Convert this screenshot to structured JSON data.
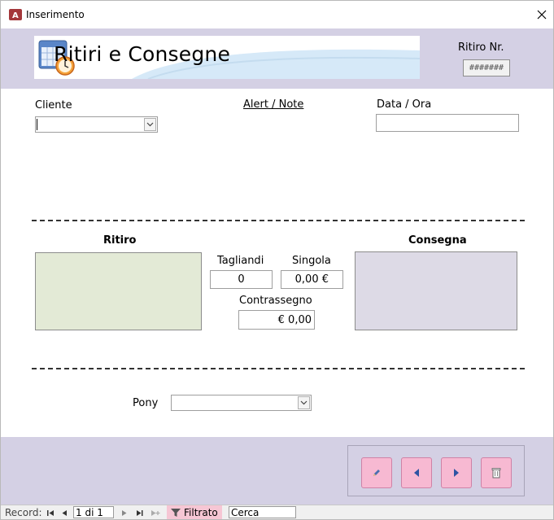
{
  "window": {
    "title": "Inserimento",
    "close_icon": "close-icon"
  },
  "header": {
    "title": "Ritiri e Consegne",
    "ritiro_nr_label": "Ritiro Nr.",
    "ritiro_nr_value": "#######"
  },
  "form": {
    "cliente_label": "Cliente",
    "cliente_value": "",
    "alert_label": "Alert / Note",
    "data_ora_label": "Data / Ora",
    "data_ora_value": "",
    "ritiro_label": "Ritiro",
    "consegna_label": "Consegna",
    "tagliandi_label": "Tagliandi",
    "tagliandi_value": "0",
    "singola_label": "Singola",
    "singola_value": "0,00 €",
    "contrassegno_label": "Contrassegno",
    "contrassegno_value": "€ 0,00",
    "pony_label": "Pony",
    "pony_value": ""
  },
  "nav_buttons": [
    {
      "name": "edit-button",
      "icon": "pencil-icon"
    },
    {
      "name": "previous-button",
      "icon": "triangle-left-icon"
    },
    {
      "name": "next-button",
      "icon": "triangle-right-icon"
    },
    {
      "name": "delete-button",
      "icon": "trash-icon"
    }
  ],
  "statusbar": {
    "record_label": "Record:",
    "record_position": "1 di 1",
    "filter_label": "Filtrato",
    "search_placeholder": "Cerca"
  },
  "colors": {
    "band": "#d4d0e4",
    "ritiro_panel": "#e3ead6",
    "consegna_panel": "#dddae6",
    "nav_button": "#f7b9d2"
  }
}
